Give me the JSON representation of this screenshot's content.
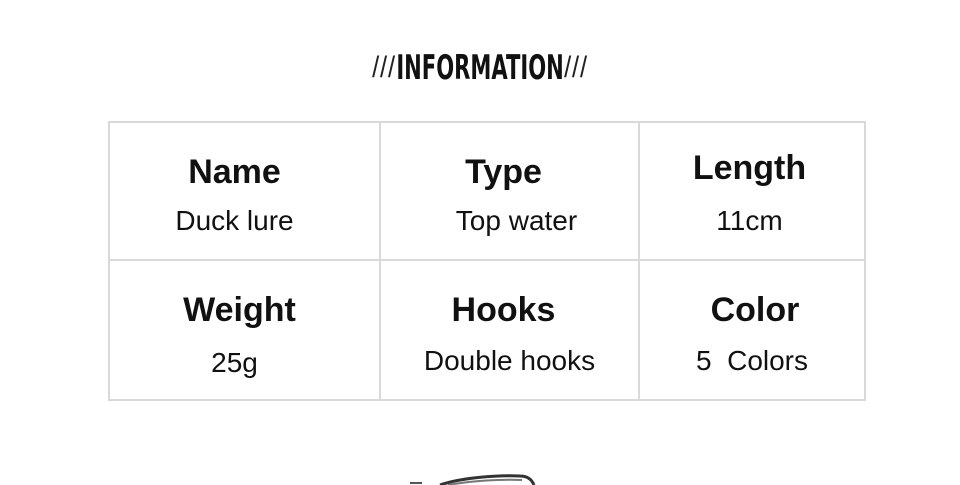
{
  "heading": {
    "prefix": "///",
    "title": "INFORMATION",
    "suffix": "///"
  },
  "specs": [
    [
      {
        "label": "Name",
        "value": "Duck lure"
      },
      {
        "label": "Type",
        "value": "Top water"
      },
      {
        "label": "Length",
        "value": "11cm"
      }
    ],
    [
      {
        "label": "Weight",
        "value": "25g"
      },
      {
        "label": "Hooks",
        "value": "Double hooks"
      },
      {
        "label": "Color",
        "value": "5  Colors"
      }
    ]
  ],
  "colors": {
    "border": "#d9d9d9",
    "text": "#111111",
    "background": "#ffffff"
  }
}
